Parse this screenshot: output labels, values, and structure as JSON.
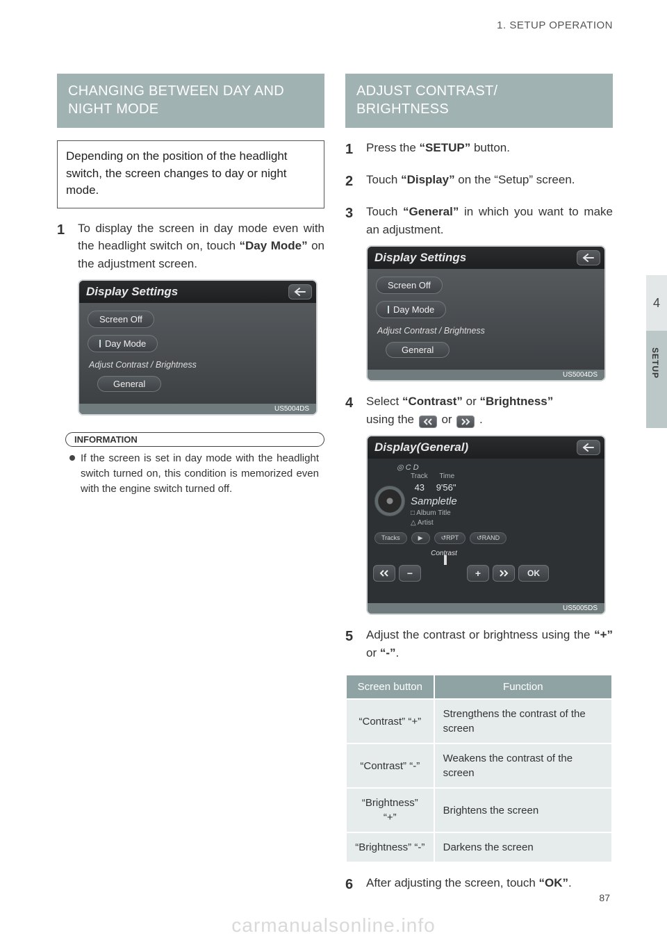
{
  "header": {
    "breadcrumb": "1. SETUP OPERATION"
  },
  "sidetab": {
    "chapter": "4",
    "label": "SETUP"
  },
  "pagenum": "87",
  "watermark": "carmanualsonline.info",
  "left": {
    "band": "CHANGING BETWEEN DAY AND NIGHT MODE",
    "intro": "Depending on the position of the head­light switch, the screen changes to day or night mode.",
    "step1_pre": "To display the screen in day mode even with the headlight switch on, touch ",
    "step1_bold": "“Day Mode”",
    "step1_post": " on the adjustment screen.",
    "info_badge": "INFORMATION",
    "info_text": "If the screen is set in day mode with the headlight switch turned on, this condition is memorized even with the engine switch turned off."
  },
  "right": {
    "band": "ADJUST CONTRAST/\nBRIGHTNESS",
    "s1_pre": "Press the ",
    "s1_bold": "“SETUP”",
    "s1_post": " button.",
    "s2_pre": "Touch ",
    "s2_bold": "“Display”",
    "s2_post": " on the “Setup” screen.",
    "s3_pre": "Touch ",
    "s3_bold": "“General”",
    "s3_post": " in which you want to make an adjustment.",
    "s4_pre": "Select ",
    "s4_b1": "“Contrast”",
    "s4_mid": " or ",
    "s4_b2": "“Brightness”",
    "s4_post1": "using the ",
    "s4_post2": " or ",
    "s4_post3": ".",
    "s5_pre": "Adjust the contrast or brightness using the ",
    "s5_b1": "“+”",
    "s5_mid": " or ",
    "s5_b2": "“-”",
    "s5_post": ".",
    "s6_pre": "After adjusting the screen, touch ",
    "s6_bold": "“OK”",
    "s6_post": "."
  },
  "fig1": {
    "title": "Display Settings",
    "btn_screen_off": "Screen Off",
    "btn_day_mode": "Day Mode",
    "label_adjust": "Adjust Contrast / Brightness",
    "btn_general": "General",
    "tag": "US5004DS"
  },
  "fig2": {
    "title": "Display(General)",
    "cd": "◎ C D",
    "track_lbl": "Track",
    "time_lbl": "Time",
    "track_no": "43",
    "time": "9'56\"",
    "sample": "Sampletle",
    "album": "□ Album Title",
    "artist": "△ Artist",
    "tracks": "Tracks",
    "play": "▶",
    "rpt": "↺RPT",
    "rand": "↺RAND",
    "contrast": "Contrast",
    "ok": "OK",
    "tag": "US5005DS"
  },
  "func_table": {
    "h1": "Screen button",
    "h2": "Function",
    "rows": [
      {
        "b": "“Contrast” “+”",
        "f": "Strengthens the contrast of the screen"
      },
      {
        "b": "“Contrast” “-”",
        "f": "Weakens the contrast of the screen"
      },
      {
        "b": "“Brightness” “+”",
        "f": "Brightens the screen"
      },
      {
        "b": "“Brightness” “-”",
        "f": "Darkens the screen"
      }
    ]
  }
}
